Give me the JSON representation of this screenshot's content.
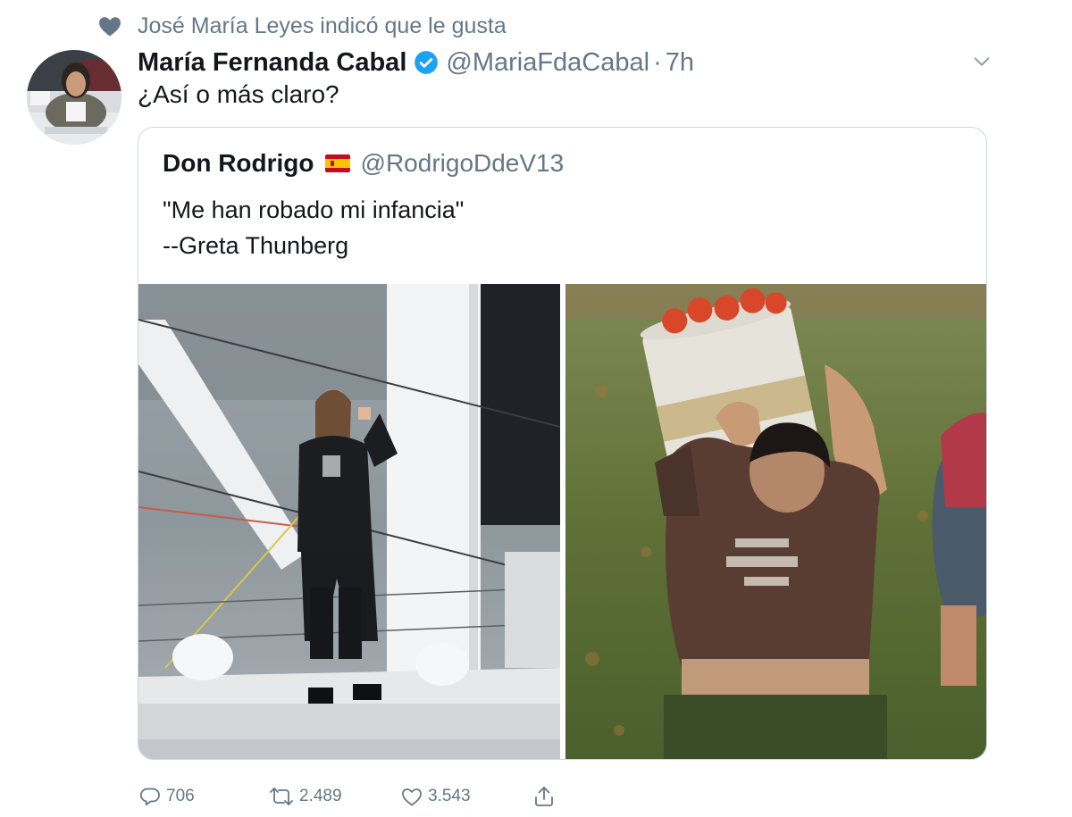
{
  "social_context": {
    "icon": "heart-icon",
    "text": "José María Leyes indicó que le gusta"
  },
  "tweet": {
    "author_name": "María Fernanda Cabal",
    "verified": true,
    "handle": "@MariaFdaCabal",
    "separator": "·",
    "time": "7h",
    "text": "¿Así o más claro?"
  },
  "quoted_tweet": {
    "author_name": "Don Rodrigo",
    "flag": "spain-flag-icon",
    "handle": "@RodrigoDdeV13",
    "text_line1": "\"Me han robado mi infancia\"",
    "text_line2": "--Greta Thunberg",
    "media": [
      "photo-girl-on-sailboat",
      "photo-boy-carrying-bucket-in-field"
    ]
  },
  "actions": {
    "reply_count": "706",
    "retweet_count": "2.489",
    "like_count": "3.543"
  },
  "colors": {
    "text_primary": "#14171a",
    "text_secondary": "#657786",
    "verified_blue": "#1da1f2",
    "border": "#ccd6dd"
  }
}
